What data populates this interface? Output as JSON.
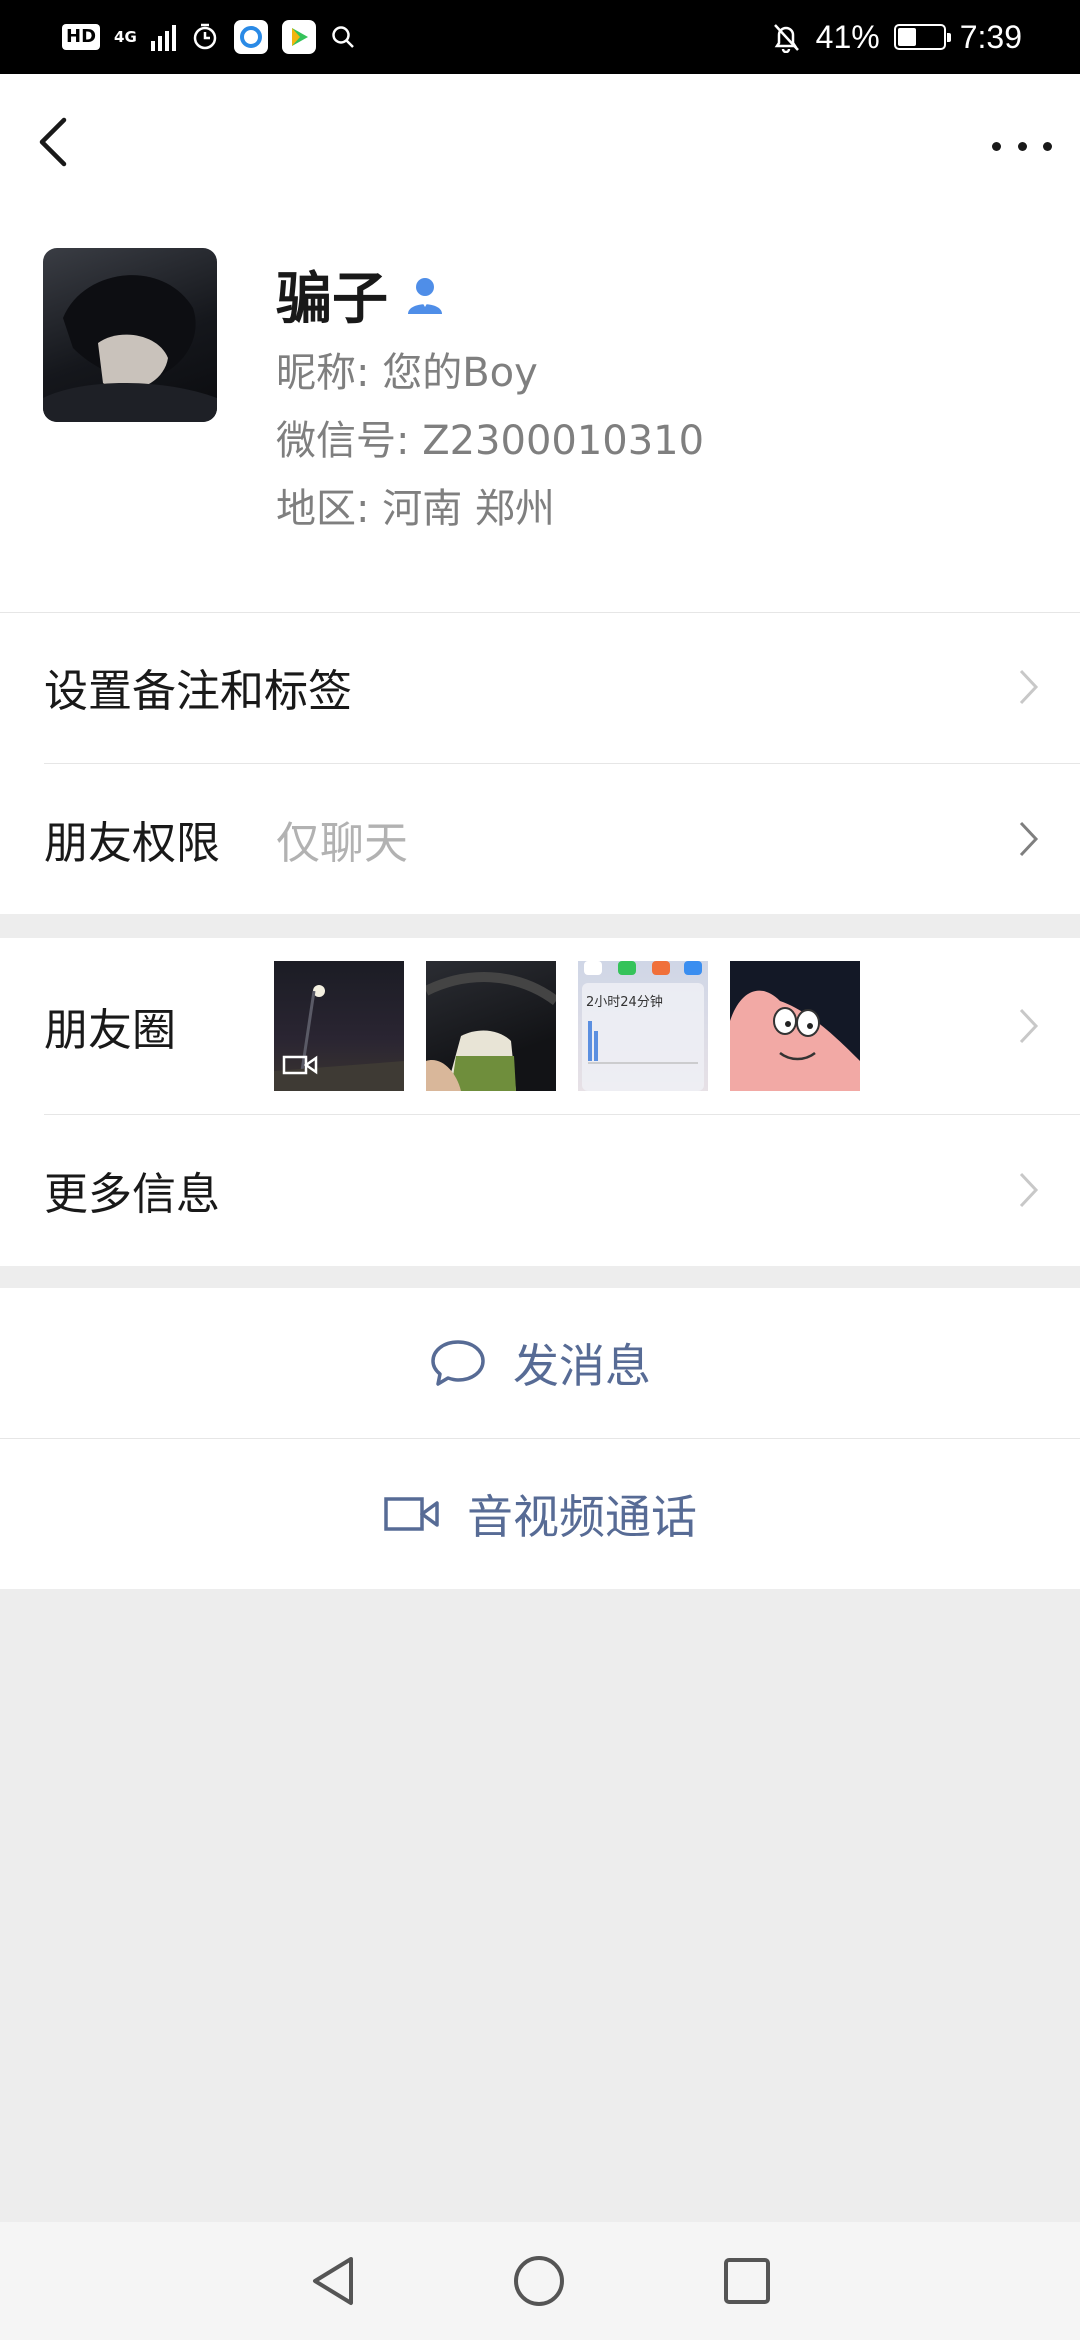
{
  "status_bar": {
    "hd": "HD",
    "network": "4G",
    "battery_percent": "41%",
    "battery_level": 0.41,
    "time": "7:39"
  },
  "profile": {
    "display_name": "骗子",
    "nickname_line": "昵称: 您的Boy",
    "wechat_id_line": "微信号: Z2300010310",
    "region_line": "地区: 河南  郑州"
  },
  "rows": {
    "remark_tags": "设置备注和标签",
    "permissions_label": "朋友权限",
    "permissions_value": "仅聊天",
    "moments_label": "朋友圈",
    "moments_thumb_text": "2小时24分钟",
    "more_info": "更多信息"
  },
  "actions": {
    "send_message": "发消息",
    "av_call": "音视频通话"
  },
  "colors": {
    "link_blue": "#576b95",
    "icon_blue": "#4f8ee8",
    "background": "#ededed"
  },
  "icons": {
    "back": "chevron-left-icon",
    "more": "more-dots-icon",
    "verified": "person-icon",
    "chat": "chat-bubble-icon",
    "video": "video-camera-icon"
  }
}
